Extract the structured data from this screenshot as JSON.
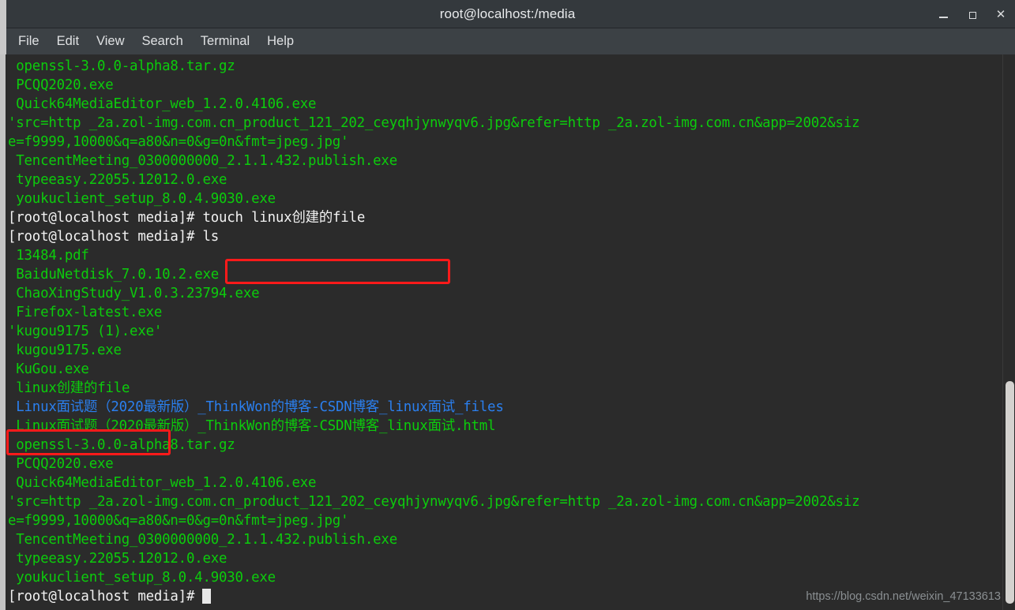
{
  "window": {
    "title": "root@localhost:/media",
    "controls": {
      "minimize": "_",
      "maximize": "▫",
      "close": "✕"
    }
  },
  "menubar": {
    "items": [
      {
        "label": "File"
      },
      {
        "label": "Edit"
      },
      {
        "label": "View"
      },
      {
        "label": "Search"
      },
      {
        "label": "Terminal"
      },
      {
        "label": "Help"
      }
    ]
  },
  "colors": {
    "background": "#2b2b2b",
    "titlebar": "#34393d",
    "menubar": "#3c4145",
    "file_green": "#0ccc0c",
    "dir_blue": "#2b7fee",
    "prompt_white": "#f2f2f2",
    "annotation_red": "#ff1a1a",
    "scrollbar_thumb": "#d4d2cf",
    "watermark": "#8a8f92"
  },
  "terminal": {
    "prompt": "[root@localhost media]# ",
    "lines": [
      {
        "text": " openssl-3.0.0-alpha8.tar.gz",
        "color": "green"
      },
      {
        "text": " PCQQ2020.exe",
        "color": "green"
      },
      {
        "text": " Quick64MediaEditor_web_1.2.0.4106.exe",
        "color": "green"
      },
      {
        "text": "'src=http _2a.zol-img.com.cn_product_121_202_ceyqhjynwyqv6.jpg&refer=http _2a.zol-img.com.cn&app=2002&siz",
        "color": "green"
      },
      {
        "text": "e=f9999,10000&q=a80&n=0&g=0n&fmt=jpeg.jpg'",
        "color": "green"
      },
      {
        "text": " TencentMeeting_0300000000_2.1.1.432.publish.exe",
        "color": "green"
      },
      {
        "text": " typeeasy.22055.12012.0.exe",
        "color": "green"
      },
      {
        "text": " youkuclient_setup_8.0.4.9030.exe",
        "color": "green"
      },
      {
        "text": "[root@localhost media]# touch linux创建的file",
        "color": "white"
      },
      {
        "text": "[root@localhost media]# ls",
        "color": "white"
      },
      {
        "text": " 13484.pdf",
        "color": "green"
      },
      {
        "text": " BaiduNetdisk_7.0.10.2.exe",
        "color": "green"
      },
      {
        "text": " ChaoXingStudy_V1.0.3.23794.exe",
        "color": "green"
      },
      {
        "text": " Firefox-latest.exe",
        "color": "green"
      },
      {
        "text": "'kugou9175 (1).exe'",
        "color": "green"
      },
      {
        "text": " kugou9175.exe",
        "color": "green"
      },
      {
        "text": " KuGou.exe",
        "color": "green"
      },
      {
        "text": " linux创建的file",
        "color": "green"
      },
      {
        "text": " Linux面试题（2020最新版）_ThinkWon的博客-CSDN博客_linux面试_files",
        "color": "blue"
      },
      {
        "text": " Linux面试题（2020最新版）_ThinkWon的博客-CSDN博客_linux面试.html",
        "color": "green"
      },
      {
        "text": " openssl-3.0.0-alpha8.tar.gz",
        "color": "green"
      },
      {
        "text": " PCQQ2020.exe",
        "color": "green"
      },
      {
        "text": " Quick64MediaEditor_web_1.2.0.4106.exe",
        "color": "green"
      },
      {
        "text": "'src=http _2a.zol-img.com.cn_product_121_202_ceyqhjynwyqv6.jpg&refer=http _2a.zol-img.com.cn&app=2002&siz",
        "color": "green"
      },
      {
        "text": "e=f9999,10000&q=a80&n=0&g=0n&fmt=jpeg.jpg'",
        "color": "green"
      },
      {
        "text": " TencentMeeting_0300000000_2.1.1.432.publish.exe",
        "color": "green"
      },
      {
        "text": " typeeasy.22055.12012.0.exe",
        "color": "green"
      },
      {
        "text": " youkuclient_setup_8.0.4.9030.exe",
        "color": "green"
      }
    ],
    "final_prompt": "[root@localhost media]# ",
    "commands": [
      {
        "name": "touch-command",
        "text": "touch linux创建的file"
      },
      {
        "name": "ls-command",
        "text": "ls"
      }
    ],
    "highlighted": [
      {
        "name": "highlight-touch-command",
        "text": "touch linux创建的file"
      },
      {
        "name": "highlight-created-file",
        "text": "linux创建的file"
      }
    ]
  },
  "watermark": {
    "text": "https://blog.csdn.net/weixin_47133613"
  }
}
